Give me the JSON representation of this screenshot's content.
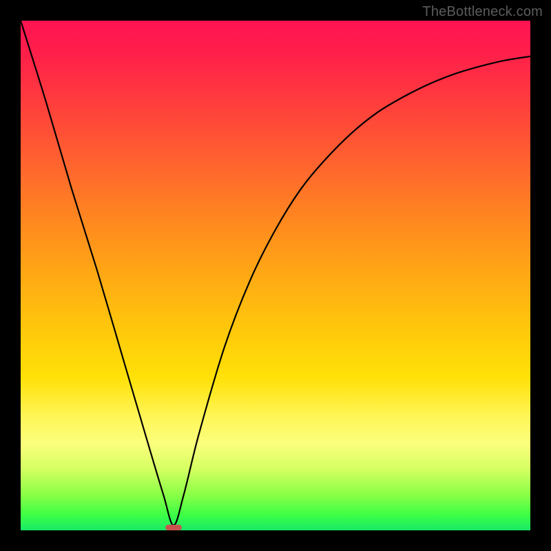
{
  "watermark": "TheBottleneck.com",
  "chart_data": {
    "type": "line",
    "title": "",
    "xlabel": "",
    "ylabel": "",
    "xlim": [
      0,
      100
    ],
    "ylim": [
      0,
      100
    ],
    "grid": false,
    "series": [
      {
        "name": "bottleneck-curve",
        "x": [
          0,
          5,
          10,
          15,
          20,
          25,
          28,
          30,
          32,
          35,
          40,
          45,
          50,
          55,
          60,
          65,
          70,
          75,
          80,
          85,
          90,
          95,
          100
        ],
        "values": [
          100,
          84,
          67,
          51,
          34,
          17,
          7,
          1,
          7,
          19,
          36,
          49,
          59,
          67,
          73,
          78,
          82,
          85,
          87.5,
          89.5,
          91,
          92.2,
          93
        ]
      }
    ],
    "minimum_marker": {
      "x_center": 30,
      "width_pct": 3.2,
      "height_pct": 1.1
    },
    "background_gradient": {
      "top": "#ff1452",
      "mid": "#ffe108",
      "bottom": "#18e866"
    }
  }
}
